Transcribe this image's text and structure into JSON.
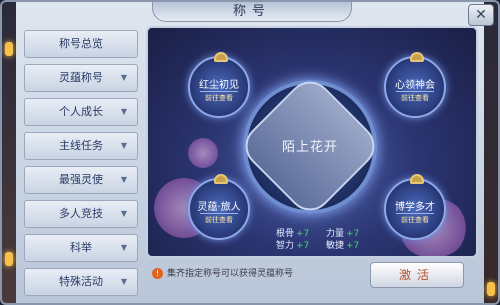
{
  "window": {
    "title": "称号"
  },
  "close_label": "✕",
  "sidebar": {
    "items": [
      {
        "label": "称号总览",
        "chevron": ""
      },
      {
        "label": "灵蕴称号",
        "chevron": "▼"
      },
      {
        "label": "个人成长",
        "chevron": "▼"
      },
      {
        "label": "主线任务",
        "chevron": "▼"
      },
      {
        "label": "最强灵使",
        "chevron": "▼"
      },
      {
        "label": "多人竞技",
        "chevron": "▼"
      },
      {
        "label": "科举",
        "chevron": "▼"
      },
      {
        "label": "特殊活动",
        "chevron": "▼"
      }
    ]
  },
  "center": {
    "title": "陌上花开"
  },
  "medals": [
    {
      "name": "红尘初见",
      "goto": "前往查看"
    },
    {
      "name": "心领神会",
      "goto": "前往查看"
    },
    {
      "name": "灵蕴·旅人",
      "goto": "前往查看"
    },
    {
      "name": "博学多才",
      "goto": "前往查看"
    }
  ],
  "stats": [
    {
      "label": "根骨",
      "value": "+7"
    },
    {
      "label": "力量",
      "value": "+7"
    },
    {
      "label": "智力",
      "value": "+7"
    },
    {
      "label": "敏捷",
      "value": "+7"
    }
  ],
  "tip": {
    "icon": "!",
    "text": "集齐指定称号可以获得灵蕴称号"
  },
  "activate_label": "激活",
  "colors": {
    "accent": "#6f8ed0",
    "gain": "#46d46e",
    "button_text": "#b5532a"
  }
}
